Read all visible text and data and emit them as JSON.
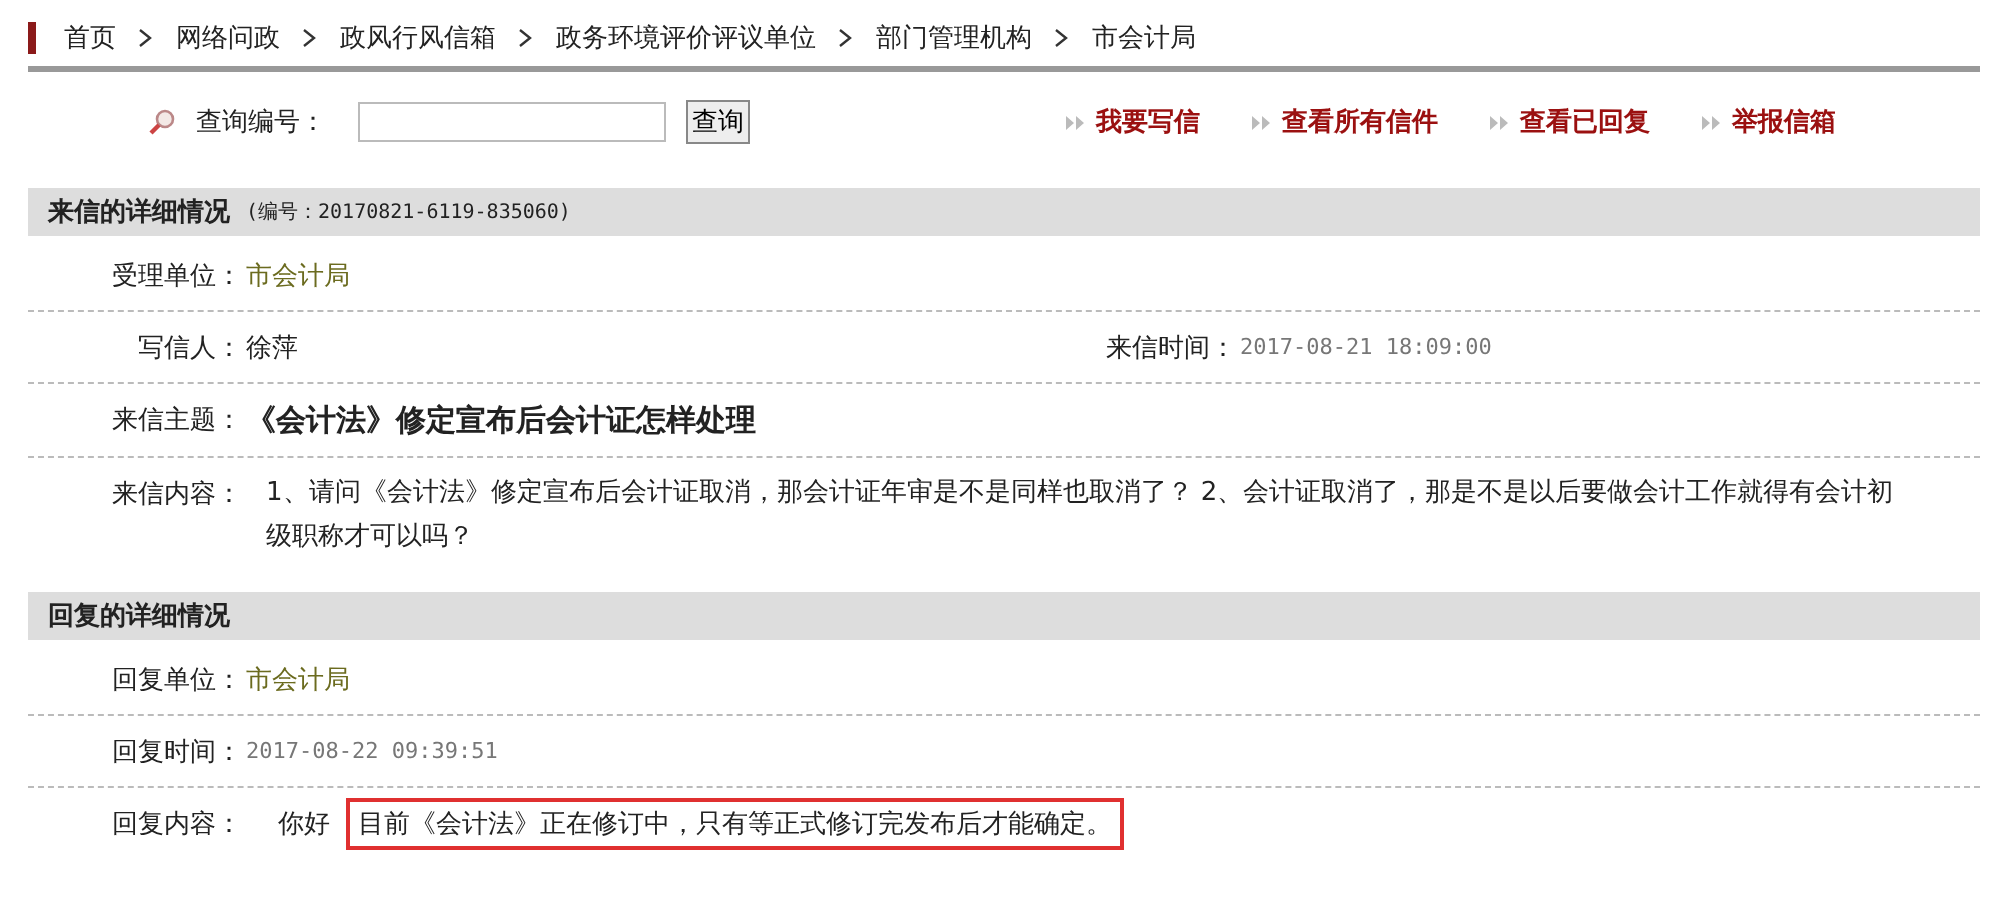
{
  "breadcrumb": [
    "首页",
    "网络问政",
    "政风行风信箱",
    "政务环境评价评议单位",
    "部门管理机构",
    "市会计局"
  ],
  "search": {
    "label": "查询编号：",
    "button": "查询"
  },
  "links": [
    "我要写信",
    "查看所有信件",
    "查看已回复",
    "举报信箱"
  ],
  "letter": {
    "title": "来信的详细情况",
    "number": "(编号：20170821-6119-835060)",
    "rows": [
      {
        "kind": "link",
        "label": "受理单位：",
        "value": "市会计局"
      },
      {
        "kind": "pair",
        "label": "写信人：",
        "value": "徐萍",
        "label2": "来信时间：",
        "value2": "2017-08-21 18:09:00"
      },
      {
        "kind": "subject",
        "label": "来信主题：",
        "value": "《会计法》修定宣布后会计证怎样处理"
      },
      {
        "kind": "text",
        "label": "来信内容：",
        "value": "1、请问《会计法》修定宣布后会计证取消，那会计证年审是不是同样也取消了？ 2、会计证取消了，那是不是以后要做会计工作就得有会计初级职称才可以吗？"
      }
    ]
  },
  "reply": {
    "title": "回复的详细情况",
    "rows": [
      {
        "kind": "link",
        "label": "回复单位：",
        "value": "市会计局"
      },
      {
        "kind": "time",
        "label": "回复时间：",
        "value": "2017-08-22 09:39:51"
      },
      {
        "kind": "parts",
        "label": "回复内容：",
        "parts": [
          {
            "text": "你好",
            "highlighted": false
          },
          {
            "text": "目前《会计法》正在修订中，只有等正式修订完发布后才能确定。",
            "highlighted": true
          }
        ]
      }
    ]
  }
}
